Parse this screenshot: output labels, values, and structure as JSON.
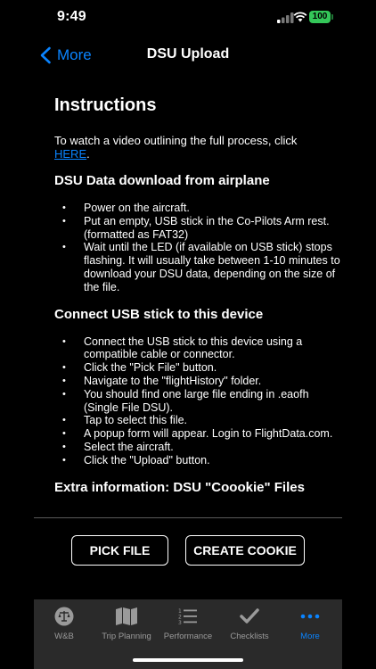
{
  "status": {
    "time": "9:49",
    "battery": "100"
  },
  "nav": {
    "back_label": "More",
    "title": "DSU Upload"
  },
  "content": {
    "title": "Instructions",
    "intro_text": "To watch a video outlining the full process, click",
    "intro_link": "HERE",
    "intro_end": ".",
    "sections": [
      {
        "title": "DSU Data download from airplane",
        "items": [
          "Power on the aircraft.",
          "Put an empty, USB stick in the Co-Pilots Arm rest. (formatted as FAT32)",
          "Wait until the LED (if available on USB stick) stops flashing. It will usually take between 1-10 minutes to download your DSU data, depending on the size of the file."
        ]
      },
      {
        "title": "Connect USB stick to this device",
        "items": [
          "Connect the USB stick to this device using a compatible cable or connector.",
          "Click the \"Pick File\" button.",
          "Navigate to the \"flightHistory\" folder.",
          "You should find one large file ending in .eaofh (Single File DSU).",
          "Tap to select this file.",
          "A popup form will appear. Login to FlightData.com.",
          "Select the aircraft.",
          "Click the \"Upload\" button."
        ]
      }
    ],
    "extra_title": "Extra information: DSU \"Coookie\" Files"
  },
  "actions": {
    "pick_file": "PICK FILE",
    "create_cookie": "CREATE COOKIE"
  },
  "tabs": [
    {
      "label": "W&B",
      "icon": "scale-icon"
    },
    {
      "label": "Trip Planning",
      "icon": "map-icon"
    },
    {
      "label": "Performance",
      "icon": "list-icon"
    },
    {
      "label": "Checklists",
      "icon": "checkmark-icon"
    },
    {
      "label": "More",
      "icon": "more-dots-icon"
    }
  ],
  "colors": {
    "accent": "#0a84ff",
    "background": "#000000",
    "tab_bar": "#2a2a2a",
    "battery": "#34c759"
  }
}
